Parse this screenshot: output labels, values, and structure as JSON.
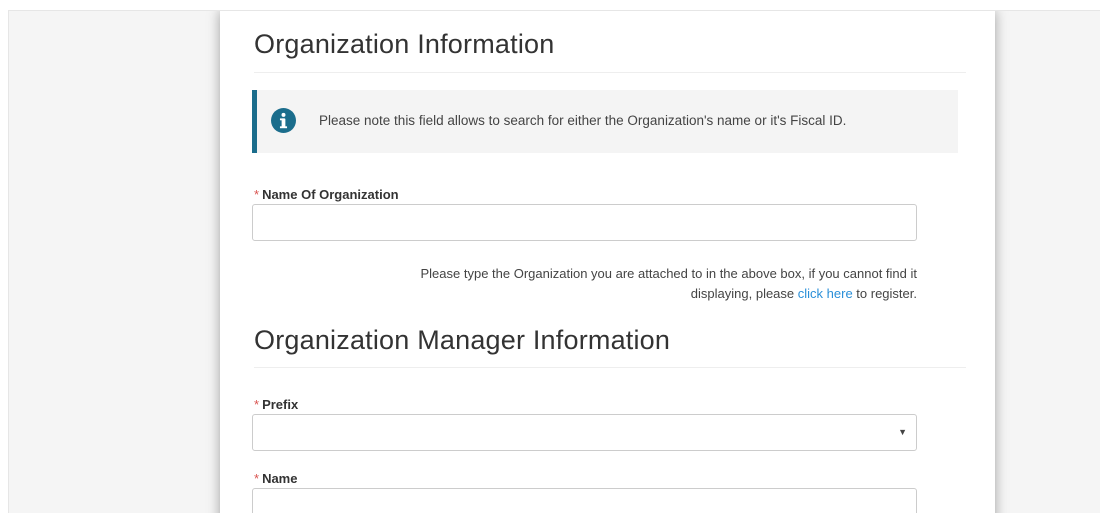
{
  "org_section": {
    "title": "Organization Information",
    "info_note": "Please note this field allows to search for either the Organization's name or it's Fiscal ID.",
    "name_field": {
      "required_marker": "*",
      "label": "Name Of Organization",
      "value": "",
      "placeholder": ""
    },
    "help": {
      "line1": "Please type the Organization you are attached to in the above box, if you cannot find it",
      "line2_prefix": "displaying, please ",
      "link_label": "click here",
      "line2_suffix": " to register."
    }
  },
  "manager_section": {
    "title": "Organization Manager Information",
    "prefix_field": {
      "required_marker": "*",
      "label": "Prefix",
      "selected_value": "",
      "icon": "chevron-down-icon"
    },
    "name_field": {
      "required_marker": "*",
      "label": "Name",
      "value": "",
      "placeholder": ""
    }
  },
  "colors": {
    "info_accent": "#1b6d8c",
    "required": "#d9534f",
    "link": "#2a8fd8"
  }
}
